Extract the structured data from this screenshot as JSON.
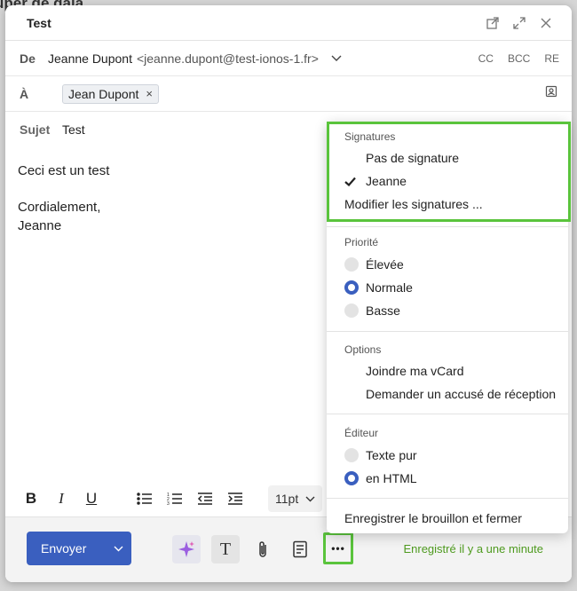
{
  "background_title": "uper de gala",
  "window": {
    "title": "Test"
  },
  "from": {
    "label": "De",
    "name": "Jeanne Dupont",
    "email": "<jeanne.dupont@test-ionos-1.fr>",
    "cc": "CC",
    "bcc": "BCC",
    "re": "RE"
  },
  "to": {
    "label": "À",
    "recipient": "Jean Dupont",
    "remove": "×"
  },
  "subject": {
    "label": "Sujet",
    "value": "Test"
  },
  "body": {
    "line1": "Ceci est un test",
    "line2": "Cordialement,",
    "line3": "Jeanne"
  },
  "format": {
    "font_size": "11pt"
  },
  "footer": {
    "send_label": "Envoyer",
    "text_tool": "T",
    "more": "•••",
    "status": "Enregistré il y a une minute"
  },
  "menu": {
    "signatures": {
      "title": "Signatures",
      "items": [
        "Pas de signature",
        "Jeanne",
        "Modifier les signatures ..."
      ],
      "checked": "Jeanne"
    },
    "priority": {
      "title": "Priorité",
      "items": [
        "Élevée",
        "Normale",
        "Basse"
      ],
      "selected": "Normale"
    },
    "options": {
      "title": "Options",
      "items": [
        "Joindre ma vCard",
        "Demander un accusé de réception"
      ]
    },
    "editor": {
      "title": "Éditeur",
      "items": [
        "Texte pur",
        "en HTML"
      ],
      "selected": "en HTML"
    },
    "save_close": "Enregistrer le brouillon et fermer"
  },
  "colors": {
    "accent": "#3a5fbf",
    "highlight": "#5ac43c",
    "status": "#4e9a1f"
  }
}
